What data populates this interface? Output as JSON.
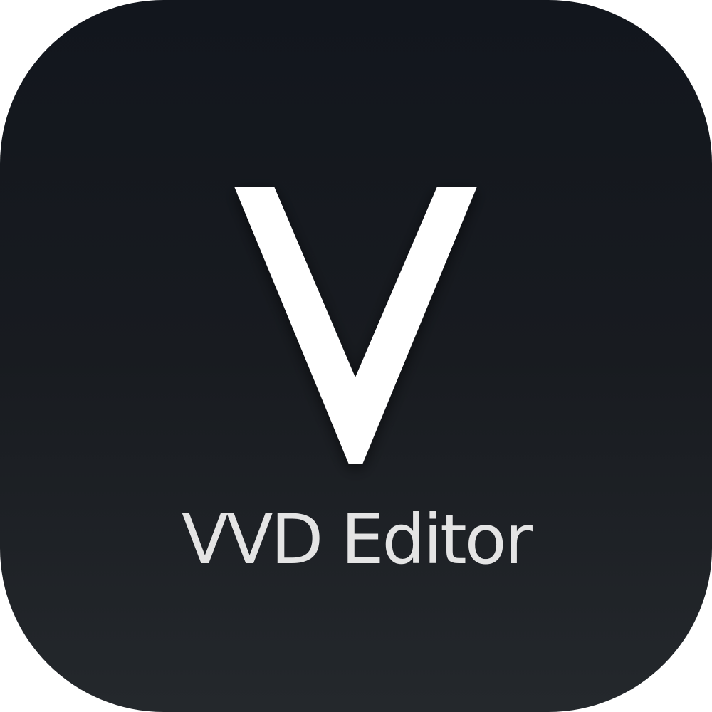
{
  "icon": {
    "logo_letter": "V",
    "app_name": "VVD Editor"
  },
  "colors": {
    "background_top": "#12161d",
    "background_bottom": "#24282c",
    "logo": "#ffffff",
    "text": "#e4e4e4"
  }
}
